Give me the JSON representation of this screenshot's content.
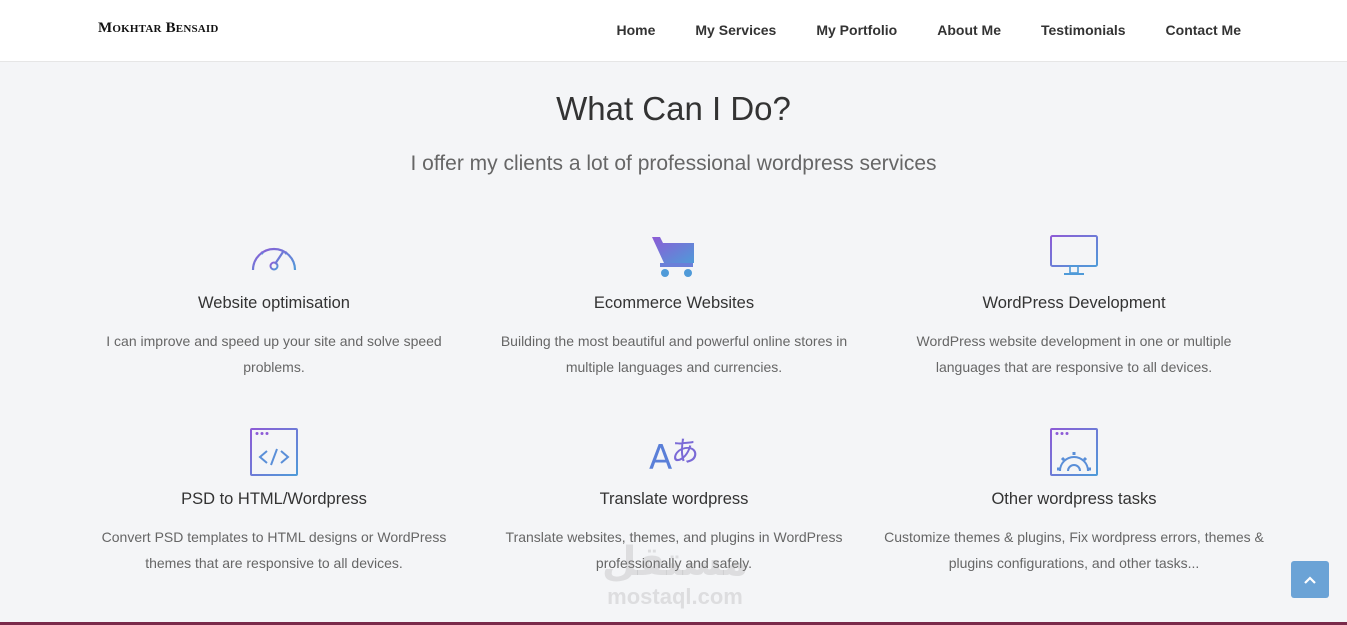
{
  "header": {
    "logo": "Mokhtar Bensaid",
    "nav": [
      "Home",
      "My Services",
      "My Portfolio",
      "About Me",
      "Testimonials",
      "Contact Me"
    ]
  },
  "section": {
    "title": "What Can I Do?",
    "subtitle": "I offer my clients a lot of professional wordpress services"
  },
  "services": [
    {
      "icon": "speedometer-icon",
      "title": "Website optimisation",
      "desc": "I can improve and speed up your site and solve speed problems."
    },
    {
      "icon": "shopping-cart-icon",
      "title": "Ecommerce Websites",
      "desc": "Building the most beautiful and powerful online stores in multiple languages and currencies."
    },
    {
      "icon": "monitor-icon",
      "title": "WordPress Development",
      "desc": "WordPress website development in one or multiple languages that are responsive to all devices."
    },
    {
      "icon": "code-window-icon",
      "title": "PSD to HTML/Wordpress",
      "desc": "Convert PSD templates to HTML designs or WordPress themes that are responsive to all devices."
    },
    {
      "icon": "translate-icon",
      "title": "Translate wordpress",
      "desc": "Translate websites, themes, and plugins in WordPress professionally and safely."
    },
    {
      "icon": "gear-window-icon",
      "title": "Other wordpress tasks",
      "desc": "Customize themes & plugins, Fix wordpress errors, themes & plugins configurations, and other tasks..."
    }
  ],
  "watermark": {
    "arabic": "مستقل",
    "latin": "mostaql.com"
  },
  "colors": {
    "icon_blue": "#5a8fd8",
    "icon_purple": "#8d5bd6",
    "scroll_button": "#6ba3d6"
  }
}
